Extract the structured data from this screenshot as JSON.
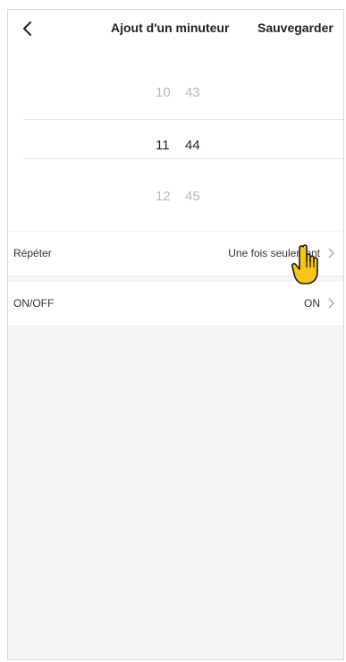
{
  "header": {
    "title": "Ajout d'un minuteur",
    "save_label": "Sauvegarder"
  },
  "picker": {
    "rows": [
      {
        "hour": "10",
        "minute": "43"
      },
      {
        "hour": "11",
        "minute": "44"
      },
      {
        "hour": "12",
        "minute": "45"
      }
    ]
  },
  "settings": [
    {
      "label": "Répéter",
      "value": "Une fois seulement"
    },
    {
      "label": "ON/OFF",
      "value": "ON"
    }
  ],
  "icons": {
    "back": "chevron-left-icon",
    "row_chevron": "chevron-right-icon",
    "cursor": "pointing-hand-cursor"
  },
  "colors": {
    "background": "#f5f5f5",
    "surface": "#ffffff",
    "dim_text": "#b8b8b8",
    "cursor_fill": "#f5c518"
  }
}
